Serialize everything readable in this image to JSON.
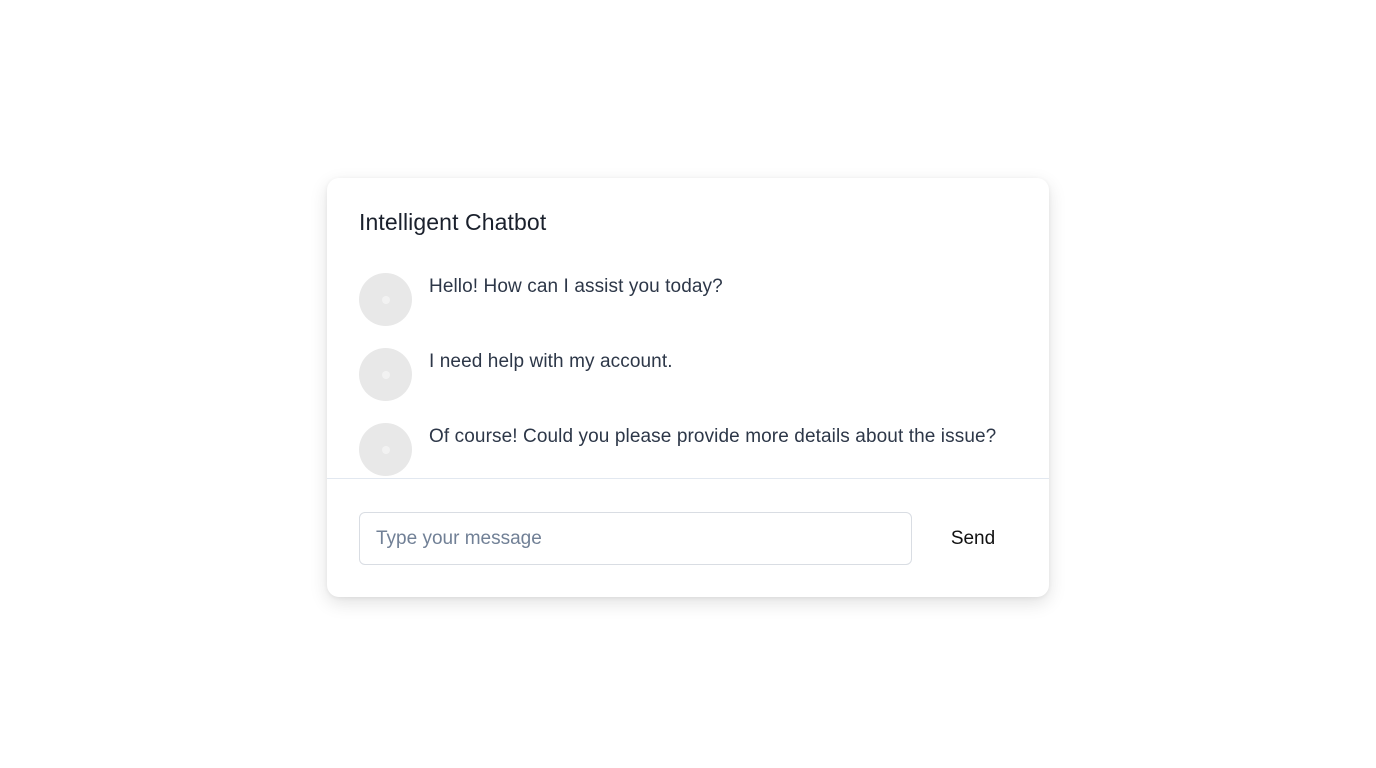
{
  "chat": {
    "title": "Intelligent Chatbot",
    "messages": [
      {
        "sender": "bot",
        "text": "Hello! How can I assist you today?"
      },
      {
        "sender": "user",
        "text": "I need help with my account."
      },
      {
        "sender": "bot",
        "text": "Of course! Could you please provide more details about the issue?"
      }
    ],
    "input": {
      "placeholder": "Type your message",
      "value": ""
    },
    "send_label": "Send"
  },
  "colors": {
    "avatar_bg": "#e8e8e8",
    "text": "#2d3748",
    "divider": "#e2e8f0"
  }
}
